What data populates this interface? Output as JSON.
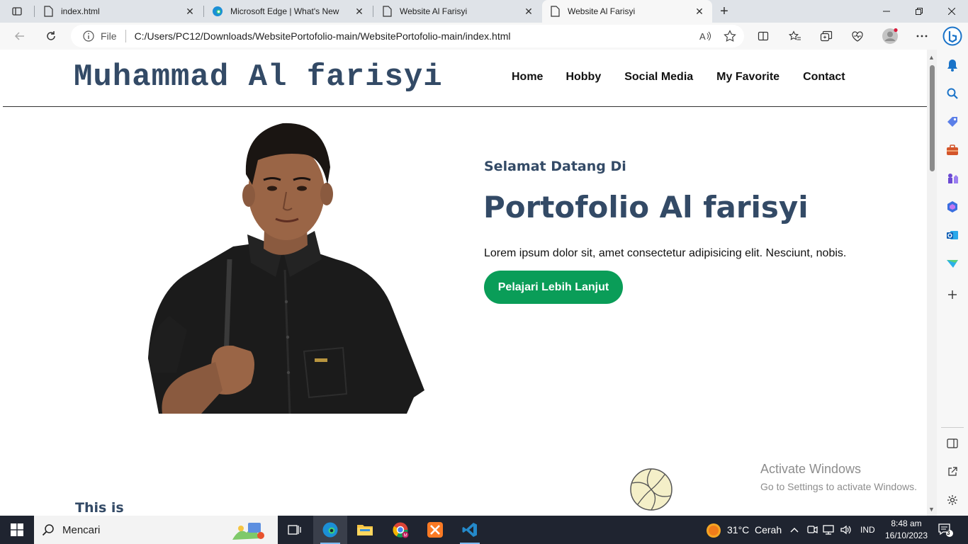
{
  "browser": {
    "tabs": [
      {
        "title": "index.html",
        "icon": "page-icon",
        "active": false
      },
      {
        "title": "Microsoft Edge | What's New",
        "icon": "edge-icon",
        "active": false
      },
      {
        "title": "Website Al Farisyi",
        "icon": "page-icon",
        "active": false
      },
      {
        "title": "Website Al Farisyi",
        "icon": "page-icon",
        "active": true
      }
    ],
    "address": {
      "scheme": "File",
      "url": "C:/Users/PC12/Downloads/WebsitePortofolio-main/WebsitePortofolio-main/index.html"
    }
  },
  "site": {
    "logo": "Muhammad Al farisyi",
    "nav": [
      "Home",
      "Hobby",
      "Social Media",
      "My Favorite",
      "Contact"
    ],
    "hero": {
      "welcome": "Selamat Datang Di",
      "title": "Portofolio Al farisyi",
      "description": "Lorem ipsum dolor sit, amet consectetur adipisicing elit. Nesciunt, nobis.",
      "cta": "Pelajari Lebih Lanjut"
    },
    "section_peek": "This is"
  },
  "watermark": {
    "line1": "Activate Windows",
    "line2": "Go to Settings to activate Windows."
  },
  "taskbar": {
    "search_placeholder": "Mencari",
    "weather": "31°C",
    "weather_desc": "Cerah",
    "language": "IND",
    "time": "8:48 am",
    "date": "16/10/2023",
    "notification_count": "3"
  },
  "colors": {
    "accent_green": "#0a9d58",
    "heading_navy": "#334a66",
    "taskbar_bg": "#1f2430"
  }
}
